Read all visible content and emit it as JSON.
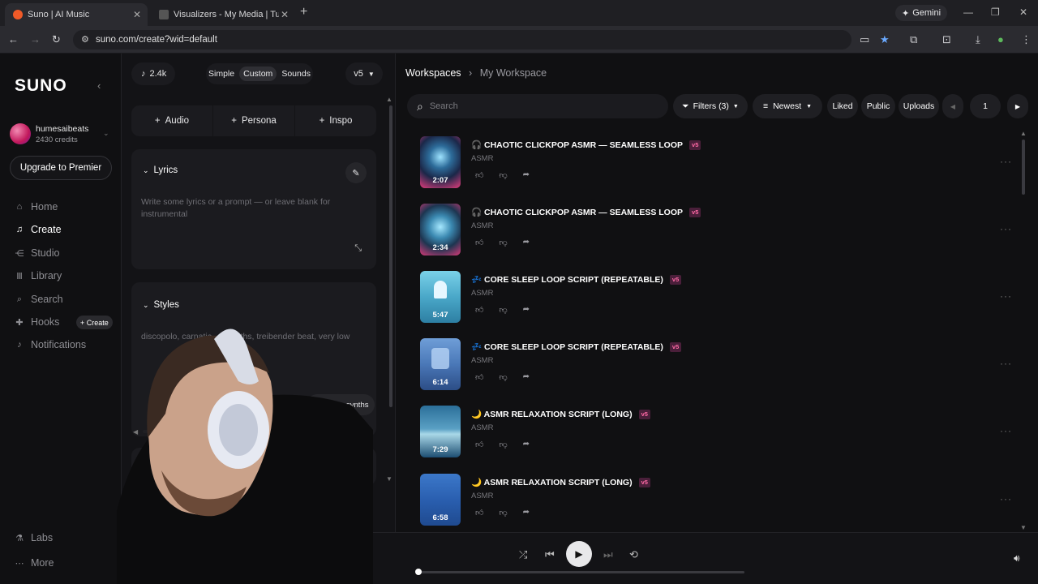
{
  "browser": {
    "tabs": [
      {
        "title": "Suno | AI Music"
      },
      {
        "title": "Visualizers - My Media | Tunefo"
      }
    ],
    "url": "suno.com/create?wid=default",
    "gemini_label": "Gemini"
  },
  "sidebar": {
    "logo": "SUNO",
    "user": {
      "name": "humesaibeats",
      "credits": "2430 credits"
    },
    "upgrade_label": "Upgrade to Premier",
    "nav": [
      {
        "label": "Home",
        "icon": "home-icon"
      },
      {
        "label": "Create",
        "icon": "music-note-icon"
      },
      {
        "label": "Studio",
        "icon": "studio-icon"
      },
      {
        "label": "Library",
        "icon": "library-icon"
      },
      {
        "label": "Search",
        "icon": "search-icon"
      },
      {
        "label": "Hooks",
        "icon": "hooks-icon"
      },
      {
        "label": "Notifications",
        "icon": "bell-icon"
      }
    ],
    "hooks_create": "+ Create",
    "bottom": [
      {
        "label": "Labs",
        "icon": "labs-icon"
      },
      {
        "label": "More",
        "icon": "more-icon"
      }
    ]
  },
  "creator": {
    "song_count": "2.4k",
    "modes": [
      "Simple",
      "Custom",
      "Sounds"
    ],
    "active_mode": "Custom",
    "model": "v5",
    "add_buttons": [
      "Audio",
      "Persona",
      "Inspo"
    ],
    "lyrics": {
      "title": "Lyrics",
      "placeholder": "Write some lyrics or a prompt — or leave blank for instrumental"
    },
    "styles": {
      "title": "Styles",
      "value": "discopolo, carnatic, … synths, treibender beat, very low",
      "tag": "exotic synths"
    }
  },
  "main": {
    "breadcrumb": {
      "root": "Workspaces",
      "current": "My Workspace"
    },
    "search_placeholder": "Search",
    "filters_label": "Filters (3)",
    "sort_label": "Newest",
    "toggles": [
      "Liked",
      "Public",
      "Uploads"
    ],
    "page": "1",
    "songs": [
      {
        "emoji": "🎧",
        "title": "CHAOTIC CLICKPOP ASMR — SEAMLESS LOOP",
        "badge": "v5",
        "genre": "ASMR",
        "duration": "2:07"
      },
      {
        "emoji": "🎧",
        "title": "CHAOTIC CLICKPOP ASMR — SEAMLESS LOOP",
        "badge": "v5",
        "genre": "ASMR",
        "duration": "2:34"
      },
      {
        "emoji": "💤",
        "title": "CORE SLEEP LOOP SCRIPT (REPEATABLE)",
        "badge": "v5",
        "genre": "ASMR",
        "duration": "5:47"
      },
      {
        "emoji": "💤",
        "title": "CORE SLEEP LOOP SCRIPT (REPEATABLE)",
        "badge": "v5",
        "genre": "ASMR",
        "duration": "6:14"
      },
      {
        "emoji": "🌙",
        "title": "ASMR RELAXATION SCRIPT (LONG)",
        "badge": "v5",
        "genre": "ASMR",
        "duration": "7:29"
      },
      {
        "emoji": "🌙",
        "title": "ASMR RELAXATION SCRIPT (LONG)",
        "badge": "v5",
        "genre": "ASMR",
        "duration": "6:58"
      }
    ]
  },
  "player": {
    "progress": 0.0
  },
  "colors": {
    "accent_badge": "#ff6aa6",
    "background": "#101012"
  }
}
